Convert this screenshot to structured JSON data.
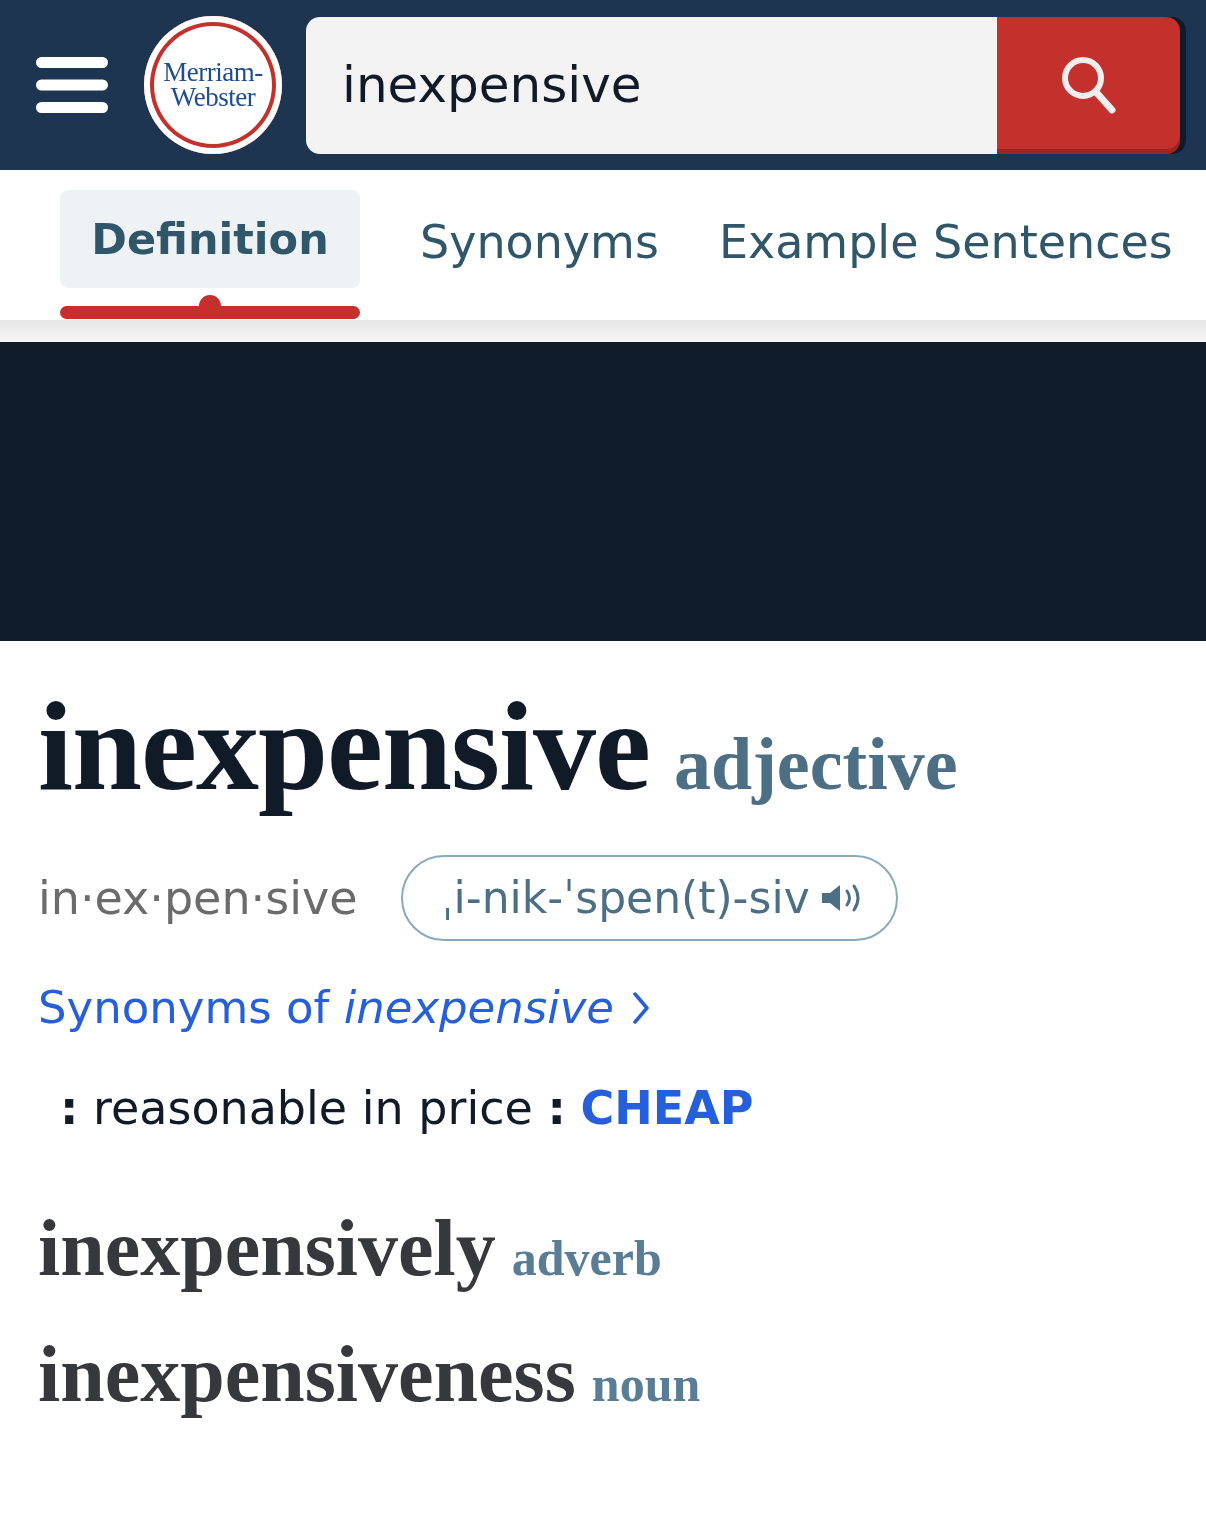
{
  "header": {
    "logo_lines": [
      "Merriam-",
      "Webster"
    ],
    "search": {
      "value": "inexpensive"
    }
  },
  "tabs": [
    {
      "label": "Definition",
      "selected": true
    },
    {
      "label": "Synonyms",
      "selected": false
    },
    {
      "label": "Example Sentences",
      "selected": false
    }
  ],
  "entry": {
    "headword": "inexpensive",
    "part_of_speech": "adjective",
    "syllables": "in·ex·pen·sive",
    "pronunciation": "ˌi-nik-ˈspen(t)-siv",
    "synonyms_link": "Synonyms of *inexpensive*",
    "definition": {
      "text": "**:** reasonable in price **:**",
      "cross_reference": "CHEAP"
    }
  },
  "run_ons": [
    {
      "word": "inexpensively",
      "part_of_speech": "adverb"
    },
    {
      "word": "inexpensiveness",
      "part_of_speech": "noun"
    }
  ]
}
